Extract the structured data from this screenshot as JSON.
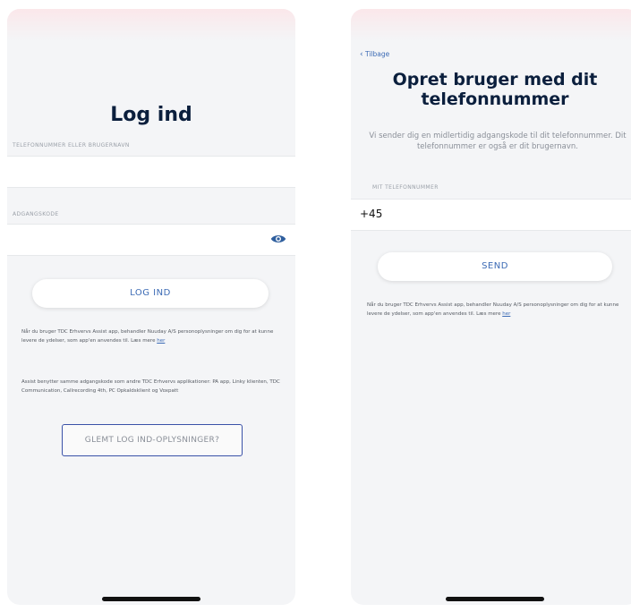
{
  "login": {
    "title": "Log ind",
    "username_label": "TELEFONNUMMER ELLER BRUGERNAVN",
    "username_value": "",
    "password_label": "ADGANGSKODE",
    "password_value": "",
    "eye_icon": "eye-icon",
    "login_button": "LOG IND",
    "privacy_text": "Når du bruger TDC Erhvervs Assist app, behandler Nuuday A/S personoplysninger om dig for at kunne levere de ydelser, som app'en anvendes til. Læs mere",
    "privacy_link": "her",
    "shared_info_text": "Assist benytter samme adgangskode som andre TDC Erhvervs applikationer: PA app, Linky klienten, TDC Communication, Callrecording 4th, PC Opkaldsklient og Voxpatt",
    "forgot_button": "GLEMT LOG IND-OPLYSNINGER?"
  },
  "signup": {
    "back_label": "Tilbage",
    "title": "Opret bruger med dit telefonnummer",
    "description": "Vi sender dig en midlertidig adgangskode til dit telefonnummer. Dit telefonnummer er også er dit brugernavn.",
    "phone_label": "MIT TELEFONNUMMER",
    "phone_prefix": "+45",
    "send_button": "SEND",
    "privacy_text": "Når du bruger TDC Erhvervs Assist app, behandler Nuuday A/S personoplysninger om dig for at kunne levere de ydelser, som app'en anvendes til. Læs mere",
    "privacy_link": "her"
  },
  "colors": {
    "accent": "#3c6bb5",
    "title": "#0b1f3d",
    "highlight_border": "#3a52a8"
  }
}
